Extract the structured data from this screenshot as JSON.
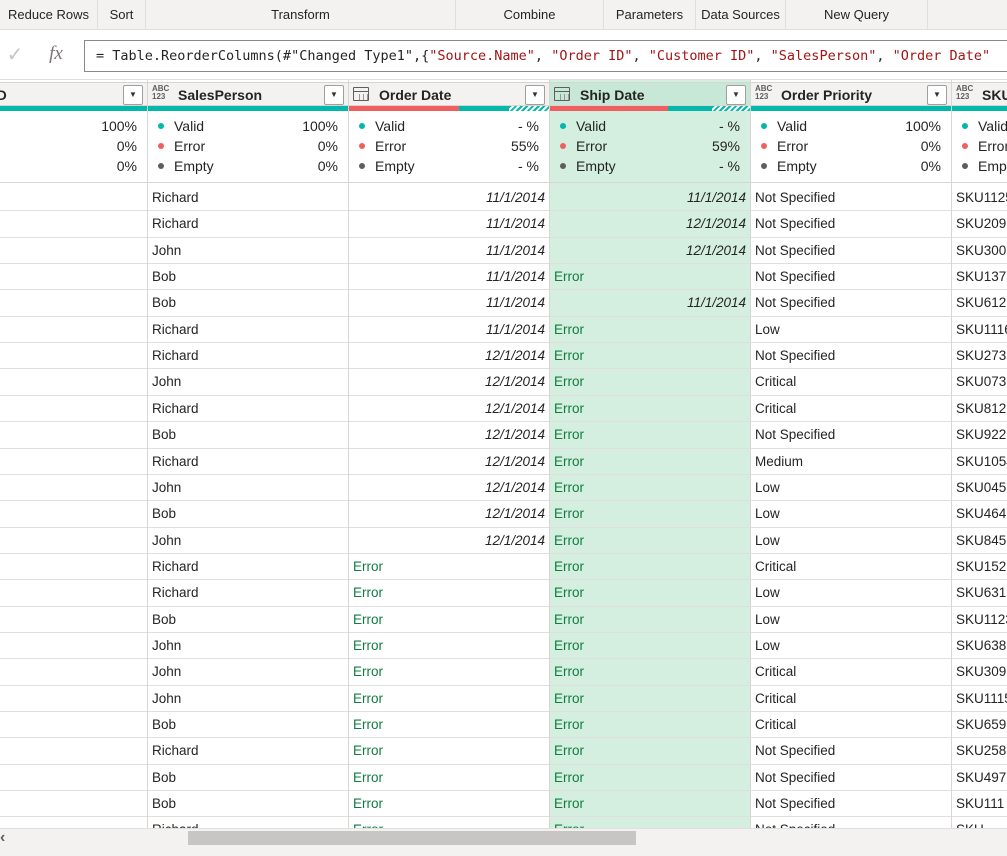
{
  "ribbon": {
    "groups": [
      {
        "label": "Reduce Rows"
      },
      {
        "label": "Sort"
      },
      {
        "label": "Transform"
      },
      {
        "label": "Combine"
      },
      {
        "label": "Parameters"
      },
      {
        "label": "Data Sources"
      },
      {
        "label": "New Query"
      }
    ]
  },
  "formula": {
    "check_icon": "check-icon",
    "fx_label": "fx",
    "prefix": "= Table.ReorderColumns(#\"Changed Type1\",{",
    "s1": "\"Source.Name\"",
    "s2": "\"Order ID\"",
    "s3": "\"Customer ID\"",
    "s4": "\"SalesPerson\"",
    "s5": "\"Order Date\"",
    "sep": ", "
  },
  "columns": [
    {
      "name": "tomer ID",
      "type_icon": "",
      "selected": false,
      "quality": {
        "valid_label": "d",
        "valid": "100%",
        "error_label": "or",
        "error": "0%",
        "empty_label": "pty",
        "empty": "0%"
      },
      "cells": [
        "",
        "",
        "",
        "",
        "",
        "",
        "",
        "",
        "",
        "",
        "",
        "",
        "",
        "",
        "",
        "",
        "",
        "",
        "",
        "",
        "",
        "",
        "",
        "",
        ""
      ]
    },
    {
      "name": "SalesPerson",
      "type_icon": "ABC123",
      "selected": false,
      "quality": {
        "valid_label": "Valid",
        "valid": "100%",
        "error_label": "Error",
        "error": "0%",
        "empty_label": "Empty",
        "empty": "0%"
      },
      "cells": [
        "Richard",
        "Richard",
        "John",
        "Bob",
        "Bob",
        "Richard",
        "Richard",
        "John",
        "Richard",
        "Bob",
        "Richard",
        "John",
        "Bob",
        "John",
        "Richard",
        "Richard",
        "Bob",
        "John",
        "John",
        "John",
        "Bob",
        "Richard",
        "Bob",
        "Bob",
        "Richard"
      ]
    },
    {
      "name": "Order Date",
      "type_icon": "calendar-icon",
      "selected": false,
      "quality": {
        "valid_label": "Valid",
        "valid": "- %",
        "error_label": "Error",
        "error": "55%",
        "empty_label": "Empty",
        "empty": "- %"
      },
      "cells": [
        "11/1/2014",
        "11/1/2014",
        "11/1/2014",
        "11/1/2014",
        "11/1/2014",
        "11/1/2014",
        "12/1/2014",
        "12/1/2014",
        "12/1/2014",
        "12/1/2014",
        "12/1/2014",
        "12/1/2014",
        "12/1/2014",
        "12/1/2014",
        "Error",
        "Error",
        "Error",
        "Error",
        "Error",
        "Error",
        "Error",
        "Error",
        "Error",
        "Error",
        "Error"
      ]
    },
    {
      "name": "Ship Date",
      "type_icon": "calendar-icon",
      "selected": true,
      "quality": {
        "valid_label": "Valid",
        "valid": "- %",
        "error_label": "Error",
        "error": "59%",
        "empty_label": "Empty",
        "empty": "- %"
      },
      "cells": [
        "11/1/2014",
        "12/1/2014",
        "12/1/2014",
        "Error",
        "11/1/2014",
        "Error",
        "Error",
        "Error",
        "Error",
        "Error",
        "Error",
        "Error",
        "Error",
        "Error",
        "Error",
        "Error",
        "Error",
        "Error",
        "Error",
        "Error",
        "Error",
        "Error",
        "Error",
        "Error",
        "Error"
      ]
    },
    {
      "name": "Order Priority",
      "type_icon": "ABC123",
      "selected": false,
      "quality": {
        "valid_label": "Valid",
        "valid": "100%",
        "error_label": "Error",
        "error": "0%",
        "empty_label": "Empty",
        "empty": "0%"
      },
      "cells": [
        "Not Specified",
        "Not Specified",
        "Not Specified",
        "Not Specified",
        "Not Specified",
        "Low",
        "Not Specified",
        "Critical",
        "Critical",
        "Not Specified",
        "Medium",
        "Low",
        "Low",
        "Low",
        "Critical",
        "Low",
        "Low",
        "Low",
        "Critical",
        "Critical",
        "Critical",
        "Not Specified",
        "Not Specified",
        "Not Specified",
        "Not Specified"
      ]
    },
    {
      "name": "SKU",
      "type_icon": "ABC123",
      "selected": false,
      "quality": {
        "valid_label": "Valid",
        "valid": "",
        "error_label": "Error",
        "error": "",
        "empty_label": "Empty",
        "empty": ""
      },
      "cells": [
        "SKU1125",
        "SKU209",
        "SKU300",
        "SKU137",
        "SKU612",
        "SKU1116",
        "SKU273",
        "SKU073",
        "SKU812",
        "SKU922",
        "SKU1054",
        "SKU045",
        "SKU464",
        "SKU845",
        "SKU152",
        "SKU631",
        "SKU1123",
        "SKU638",
        "SKU309",
        "SKU1115",
        "SKU659",
        "SKU258",
        "SKU497",
        "SKU111",
        "SKU"
      ]
    }
  ],
  "colors": {
    "valid": "#01b8aa",
    "error": "#f05f5f",
    "empty": "#605e5c",
    "selected_column": "#d4efdf"
  },
  "scrollbar": {
    "left_arrow_icon": "chevron-left-icon"
  }
}
